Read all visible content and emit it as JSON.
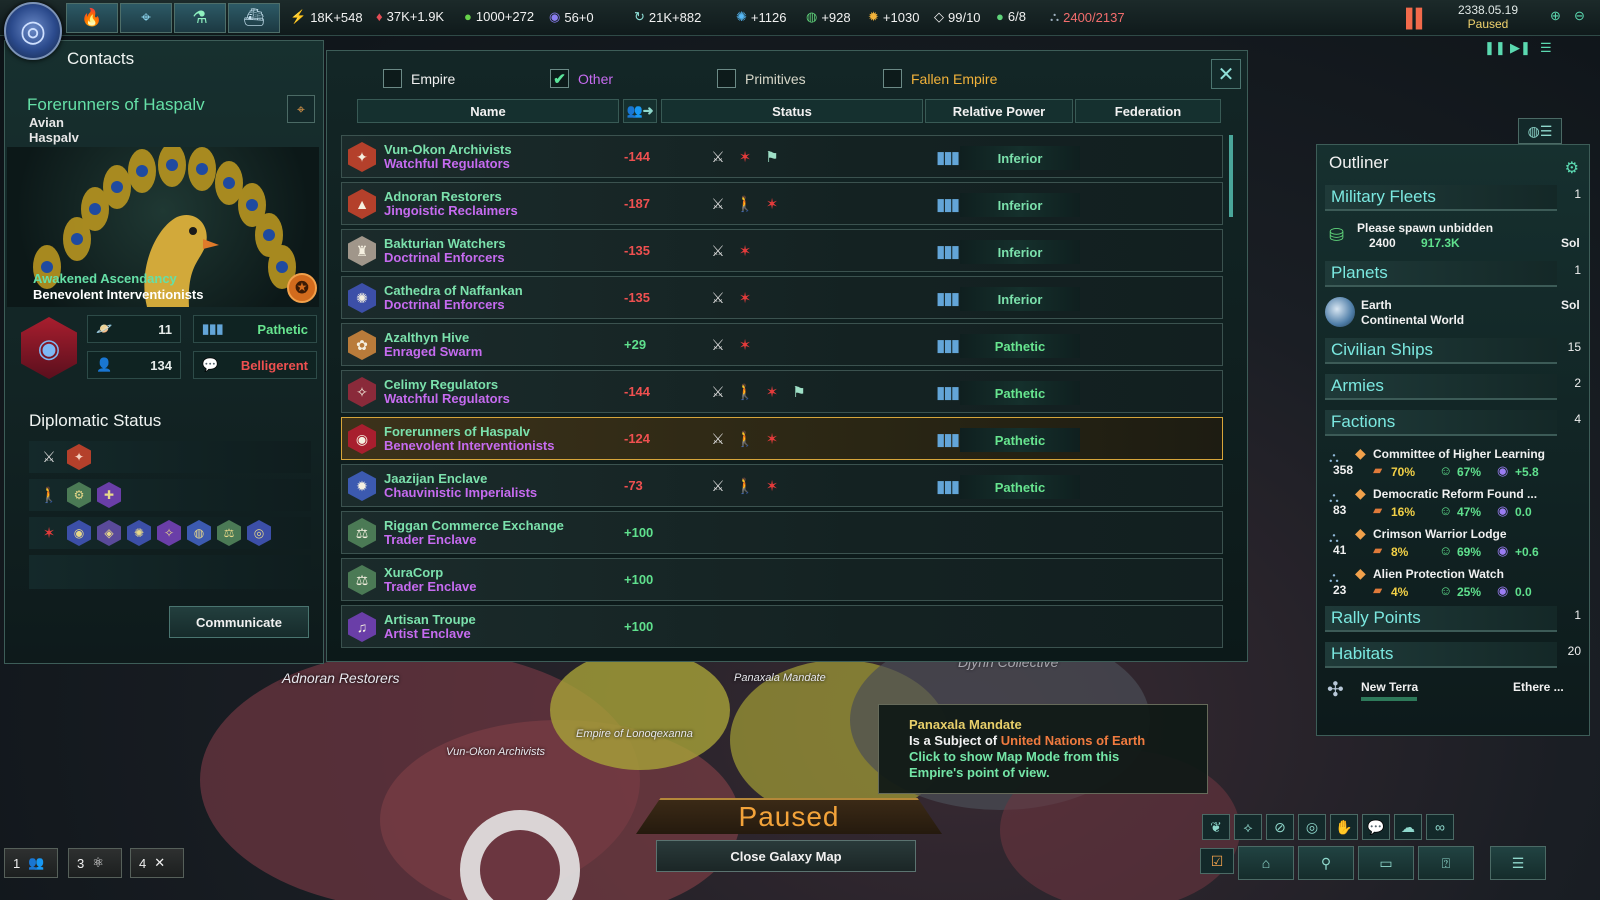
{
  "top_bar": {
    "views": [
      {
        "icon": "fire-icon"
      },
      {
        "icon": "map-icon"
      },
      {
        "icon": "flask-icon"
      },
      {
        "icon": "ship-icon"
      }
    ],
    "resources": [
      {
        "icon": "energy-icon",
        "glyph": "⚡",
        "value": "18K+548",
        "color": "#f2d046"
      },
      {
        "icon": "minerals-icon",
        "glyph": "♦",
        "value": "37K+1.9K",
        "color": "#e34d56"
      },
      {
        "icon": "food-icon",
        "glyph": "●",
        "value": "1000+272",
        "color": "#67d34b"
      },
      {
        "icon": "consumer-goods-icon",
        "glyph": "◉",
        "value": "56+0",
        "color": "#8b7ef2"
      },
      {
        "icon": "influence-icon",
        "glyph": "↻",
        "value": "21K+882",
        "color": "#8fe0d8"
      },
      {
        "icon": "research-icon",
        "glyph": "✺",
        "value": "+1126",
        "color": "#56b8f5"
      },
      {
        "icon": "society-icon",
        "glyph": "◍",
        "value": "+928",
        "color": "#5fd37a"
      },
      {
        "icon": "engineering-icon",
        "glyph": "✹",
        "value": "+1030",
        "color": "#f2b23a"
      },
      {
        "icon": "unity-icon",
        "glyph": "◇",
        "value": "99/10",
        "color": "#f1f1f1"
      },
      {
        "icon": "amenities-icon",
        "glyph": "●",
        "value": "6/8",
        "color": "#5fd37a"
      },
      {
        "icon": "fleet-cap-icon",
        "glyph": "⛬",
        "value": "2400/2137",
        "color": "#f36d6d"
      }
    ],
    "date": "2338.05.19",
    "state": "Paused"
  },
  "contacts": {
    "title": "Contacts",
    "empire_name": "Forerunners of Haspalv",
    "species": "Avian",
    "homeworld": "Haspalv",
    "authority": "Awakened Ascendancy",
    "ethics": "Benevolent Interventionists",
    "planets": "11",
    "pops": "134",
    "power": "Pathetic",
    "attitude": "Belligerent",
    "diplomatic_status_title": "Diplomatic Status",
    "communicate": "Communicate"
  },
  "filters": [
    {
      "label": "Empire",
      "checked": false,
      "color": "#f1f1f1"
    },
    {
      "label": "Other",
      "checked": true,
      "color": "#c66bf0"
    },
    {
      "label": "Primitives",
      "checked": false,
      "color": "#d6d6c8"
    },
    {
      "label": "Fallen Empire",
      "checked": false,
      "color": "#f2b23a"
    }
  ],
  "columns": {
    "name": "Name",
    "status": "Status",
    "relative_power": "Relative Power",
    "federation": "Federation"
  },
  "empires": [
    {
      "name": "Vun-Okon Archivists",
      "gov": "Watchful Regulators",
      "opinion": "-144",
      "status": [
        "war",
        "pact",
        "flag"
      ],
      "power": "Inferior",
      "shield": "#b4402b",
      "glyph": "✦"
    },
    {
      "name": "Adnoran Restorers",
      "gov": "Jingoistic Reclaimers",
      "opinion": "-187",
      "status": [
        "war",
        "walk",
        "pact"
      ],
      "power": "Inferior",
      "shield": "#b4402b",
      "glyph": "▲"
    },
    {
      "name": "Bakturian Watchers",
      "gov": "Doctrinal Enforcers",
      "opinion": "-135",
      "status": [
        "war",
        "pact"
      ],
      "power": "Inferior",
      "shield": "#a0968a",
      "glyph": "♜"
    },
    {
      "name": "Cathedra of Naffankan",
      "gov": "Doctrinal Enforcers",
      "opinion": "-135",
      "status": [
        "war",
        "pact"
      ],
      "power": "Inferior",
      "shield": "#3c4fa8",
      "glyph": "✺"
    },
    {
      "name": "Azalthyn Hive",
      "gov": "Enraged Swarm",
      "opinion": "+29",
      "status": [
        "war",
        "pact"
      ],
      "power": "Pathetic",
      "shield": "#b97b3a",
      "glyph": "✿"
    },
    {
      "name": "Celimy Regulators",
      "gov": "Watchful Regulators",
      "opinion": "-144",
      "status": [
        "war",
        "walk",
        "pact",
        "flag"
      ],
      "power": "Pathetic",
      "shield": "#8a2a3a",
      "glyph": "✧"
    },
    {
      "name": "Forerunners of Haspalv",
      "gov": "Benevolent Interventionists",
      "opinion": "-124",
      "status": [
        "war",
        "walk",
        "pact"
      ],
      "power": "Pathetic",
      "shield": "#a81e2e",
      "glyph": "◉",
      "selected": true
    },
    {
      "name": "Jaazijan Enclave",
      "gov": "Chauvinistic Imperialists",
      "opinion": "-73",
      "status": [
        "war",
        "walk",
        "pact"
      ],
      "power": "Pathetic",
      "shield": "#3c5ab0",
      "glyph": "✹"
    },
    {
      "name": "Riggan Commerce Exchange",
      "gov": "Trader Enclave",
      "opinion": "+100",
      "status": [],
      "power": "",
      "shield": "#4b7a55",
      "glyph": "⚖"
    },
    {
      "name": "XuraCorp",
      "gov": "Trader Enclave",
      "opinion": "+100",
      "status": [],
      "power": "",
      "shield": "#4b7a55",
      "glyph": "⚖"
    },
    {
      "name": "Artisan Troupe",
      "gov": "Artist Enclave",
      "opinion": "+100",
      "status": [],
      "power": "",
      "shield": "#6a3ea8",
      "glyph": "♫"
    }
  ],
  "outliner": {
    "title": "Outliner",
    "military_fleets": {
      "label": "Military Fleets",
      "count": "1"
    },
    "fleet": {
      "name": "Please spawn unbidden",
      "size": "2400",
      "power": "917.3K",
      "location": "Sol"
    },
    "planets": {
      "label": "Planets",
      "count": "1"
    },
    "planet": {
      "name": "Earth",
      "type": "Continental World",
      "location": "Sol"
    },
    "civilian_ships": {
      "label": "Civilian Ships",
      "count": "15"
    },
    "armies": {
      "label": "Armies",
      "count": "2"
    },
    "factions": {
      "label": "Factions",
      "count": "4"
    },
    "faction_list": [
      {
        "name": "Committee of Higher Learning",
        "members": "358",
        "support": "70%",
        "approval": "67%",
        "influence": "+5.8"
      },
      {
        "name": "Democratic Reform Found ...",
        "members": "83",
        "support": "16%",
        "approval": "47%",
        "influence": "0.0"
      },
      {
        "name": "Crimson Warrior Lodge",
        "members": "41",
        "support": "8%",
        "approval": "69%",
        "influence": "+0.6"
      },
      {
        "name": "Alien Protection Watch",
        "members": "23",
        "support": "4%",
        "approval": "25%",
        "influence": "0.0"
      }
    ],
    "rally_points": {
      "label": "Rally Points",
      "count": "1"
    },
    "habitats": {
      "label": "Habitats",
      "count": "20"
    },
    "habitat": {
      "name": "New Terra",
      "location": "Ethere ..."
    }
  },
  "map": {
    "labels": [
      {
        "text": "Adnoran Restorers",
        "size": "big"
      },
      {
        "text": "Vun-Okon Archivists",
        "size": "small"
      },
      {
        "text": "Empire of Lonoqexanna",
        "size": "small"
      },
      {
        "text": "Panaxala Mandate",
        "size": "small"
      },
      {
        "text": "Djynn Collective",
        "size": "big"
      }
    ]
  },
  "tooltip": {
    "title": "Panaxala Mandate",
    "line_prefix": "Is a Subject of ",
    "overlord": "United Nations of Earth",
    "hint": "Click to show Map Mode from this Empire's point of view."
  },
  "bottom": {
    "paused": "Paused",
    "close_map": "Close Galaxy Map",
    "speed_buttons": [
      {
        "num": "1",
        "icon": "population-icon"
      },
      {
        "num": "3",
        "icon": "atom-icon"
      },
      {
        "num": "4",
        "icon": "tools-icon"
      }
    ]
  }
}
